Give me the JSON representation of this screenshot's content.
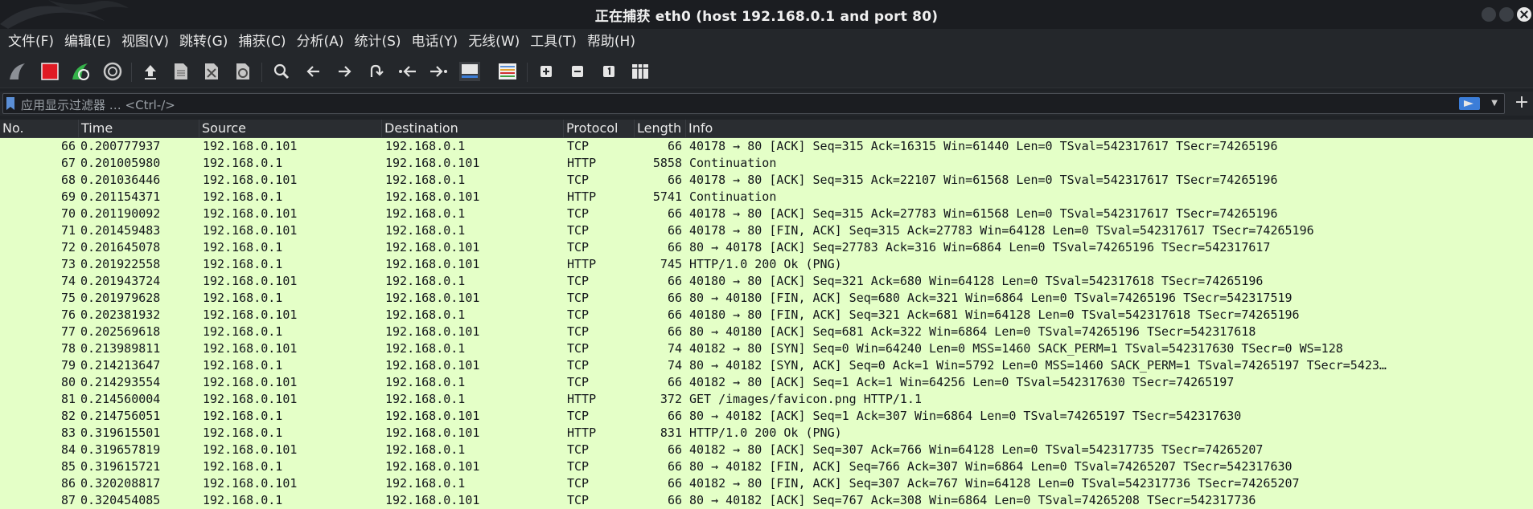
{
  "window": {
    "title": "正在捕获 eth0 (host 192.168.0.1 and port 80)"
  },
  "menu": [
    "文件(F)",
    "编辑(E)",
    "视图(V)",
    "跳转(G)",
    "捕获(C)",
    "分析(A)",
    "统计(S)",
    "电话(Y)",
    "无线(W)",
    "工具(T)",
    "帮助(H)"
  ],
  "toolbar_icons": [
    "shark-fin-start-icon",
    "stop-capture-icon",
    "restart-capture-icon",
    "capture-options-icon",
    "open-file-icon",
    "save-file-icon",
    "close-file-icon",
    "reload-file-icon",
    "find-packet-icon",
    "go-back-icon",
    "go-forward-icon",
    "go-to-packet-icon",
    "first-packet-icon",
    "last-packet-icon",
    "autoscroll-icon",
    "colorize-icon",
    "zoom-in-icon",
    "zoom-out-icon",
    "normal-size-icon",
    "resize-columns-icon"
  ],
  "filter": {
    "placeholder": "应用显示过滤器 … <Ctrl-/>"
  },
  "columns": {
    "no": "No.",
    "time": "Time",
    "source": "Source",
    "destination": "Destination",
    "protocol": "Protocol",
    "length": "Length",
    "info": "Info"
  },
  "colors": {
    "row_bg": "#e4ffc7",
    "header_bg": "#2a2d31",
    "window_bg": "#1f2226",
    "accent": "#3b7dd8"
  },
  "packets": [
    {
      "no": "66",
      "time": "0.200777937",
      "source": "192.168.0.101",
      "destination": "192.168.0.1",
      "protocol": "TCP",
      "length": "66",
      "info": "40178 → 80 [ACK] Seq=315 Ack=16315 Win=61440 Len=0 TSval=542317617 TSecr=74265196"
    },
    {
      "no": "67",
      "time": "0.201005980",
      "source": "192.168.0.1",
      "destination": "192.168.0.101",
      "protocol": "HTTP",
      "length": "5858",
      "info": "Continuation"
    },
    {
      "no": "68",
      "time": "0.201036446",
      "source": "192.168.0.101",
      "destination": "192.168.0.1",
      "protocol": "TCP",
      "length": "66",
      "info": "40178 → 80 [ACK] Seq=315 Ack=22107 Win=61568 Len=0 TSval=542317617 TSecr=74265196"
    },
    {
      "no": "69",
      "time": "0.201154371",
      "source": "192.168.0.1",
      "destination": "192.168.0.101",
      "protocol": "HTTP",
      "length": "5741",
      "info": "Continuation"
    },
    {
      "no": "70",
      "time": "0.201190092",
      "source": "192.168.0.101",
      "destination": "192.168.0.1",
      "protocol": "TCP",
      "length": "66",
      "info": "40178 → 80 [ACK] Seq=315 Ack=27783 Win=61568 Len=0 TSval=542317617 TSecr=74265196"
    },
    {
      "no": "71",
      "time": "0.201459483",
      "source": "192.168.0.101",
      "destination": "192.168.0.1",
      "protocol": "TCP",
      "length": "66",
      "info": "40178 → 80 [FIN, ACK] Seq=315 Ack=27783 Win=64128 Len=0 TSval=542317617 TSecr=74265196"
    },
    {
      "no": "72",
      "time": "0.201645078",
      "source": "192.168.0.1",
      "destination": "192.168.0.101",
      "protocol": "TCP",
      "length": "66",
      "info": "80 → 40178 [ACK] Seq=27783 Ack=316 Win=6864 Len=0 TSval=74265196 TSecr=542317617"
    },
    {
      "no": "73",
      "time": "0.201922558",
      "source": "192.168.0.1",
      "destination": "192.168.0.101",
      "protocol": "HTTP",
      "length": "745",
      "info": "HTTP/1.0 200 Ok  (PNG)"
    },
    {
      "no": "74",
      "time": "0.201943724",
      "source": "192.168.0.101",
      "destination": "192.168.0.1",
      "protocol": "TCP",
      "length": "66",
      "info": "40180 → 80 [ACK] Seq=321 Ack=680 Win=64128 Len=0 TSval=542317618 TSecr=74265196"
    },
    {
      "no": "75",
      "time": "0.201979628",
      "source": "192.168.0.1",
      "destination": "192.168.0.101",
      "protocol": "TCP",
      "length": "66",
      "info": "80 → 40180 [FIN, ACK] Seq=680 Ack=321 Win=6864 Len=0 TSval=74265196 TSecr=542317519"
    },
    {
      "no": "76",
      "time": "0.202381932",
      "source": "192.168.0.101",
      "destination": "192.168.0.1",
      "protocol": "TCP",
      "length": "66",
      "info": "40180 → 80 [FIN, ACK] Seq=321 Ack=681 Win=64128 Len=0 TSval=542317618 TSecr=74265196"
    },
    {
      "no": "77",
      "time": "0.202569618",
      "source": "192.168.0.1",
      "destination": "192.168.0.101",
      "protocol": "TCP",
      "length": "66",
      "info": "80 → 40180 [ACK] Seq=681 Ack=322 Win=6864 Len=0 TSval=74265196 TSecr=542317618"
    },
    {
      "no": "78",
      "time": "0.213989811",
      "source": "192.168.0.101",
      "destination": "192.168.0.1",
      "protocol": "TCP",
      "length": "74",
      "info": "40182 → 80 [SYN] Seq=0 Win=64240 Len=0 MSS=1460 SACK_PERM=1 TSval=542317630 TSecr=0 WS=128"
    },
    {
      "no": "79",
      "time": "0.214213647",
      "source": "192.168.0.1",
      "destination": "192.168.0.101",
      "protocol": "TCP",
      "length": "74",
      "info": "80 → 40182 [SYN, ACK] Seq=0 Ack=1 Win=5792 Len=0 MSS=1460 SACK_PERM=1 TSval=74265197 TSecr=5423…"
    },
    {
      "no": "80",
      "time": "0.214293554",
      "source": "192.168.0.101",
      "destination": "192.168.0.1",
      "protocol": "TCP",
      "length": "66",
      "info": "40182 → 80 [ACK] Seq=1 Ack=1 Win=64256 Len=0 TSval=542317630 TSecr=74265197"
    },
    {
      "no": "81",
      "time": "0.214560004",
      "source": "192.168.0.101",
      "destination": "192.168.0.1",
      "protocol": "HTTP",
      "length": "372",
      "info": "GET /images/favicon.png HTTP/1.1"
    },
    {
      "no": "82",
      "time": "0.214756051",
      "source": "192.168.0.1",
      "destination": "192.168.0.101",
      "protocol": "TCP",
      "length": "66",
      "info": "80 → 40182 [ACK] Seq=1 Ack=307 Win=6864 Len=0 TSval=74265197 TSecr=542317630"
    },
    {
      "no": "83",
      "time": "0.319615501",
      "source": "192.168.0.1",
      "destination": "192.168.0.101",
      "protocol": "HTTP",
      "length": "831",
      "info": "HTTP/1.0 200 Ok  (PNG)"
    },
    {
      "no": "84",
      "time": "0.319657819",
      "source": "192.168.0.101",
      "destination": "192.168.0.1",
      "protocol": "TCP",
      "length": "66",
      "info": "40182 → 80 [ACK] Seq=307 Ack=766 Win=64128 Len=0 TSval=542317735 TSecr=74265207"
    },
    {
      "no": "85",
      "time": "0.319615721",
      "source": "192.168.0.1",
      "destination": "192.168.0.101",
      "protocol": "TCP",
      "length": "66",
      "info": "80 → 40182 [FIN, ACK] Seq=766 Ack=307 Win=6864 Len=0 TSval=74265207 TSecr=542317630"
    },
    {
      "no": "86",
      "time": "0.320208817",
      "source": "192.168.0.101",
      "destination": "192.168.0.1",
      "protocol": "TCP",
      "length": "66",
      "info": "40182 → 80 [FIN, ACK] Seq=307 Ack=767 Win=64128 Len=0 TSval=542317736 TSecr=74265207"
    },
    {
      "no": "87",
      "time": "0.320454085",
      "source": "192.168.0.1",
      "destination": "192.168.0.101",
      "protocol": "TCP",
      "length": "66",
      "info": "80 → 40182 [ACK] Seq=767 Ack=308 Win=6864 Len=0 TSval=74265208 TSecr=542317736"
    }
  ]
}
